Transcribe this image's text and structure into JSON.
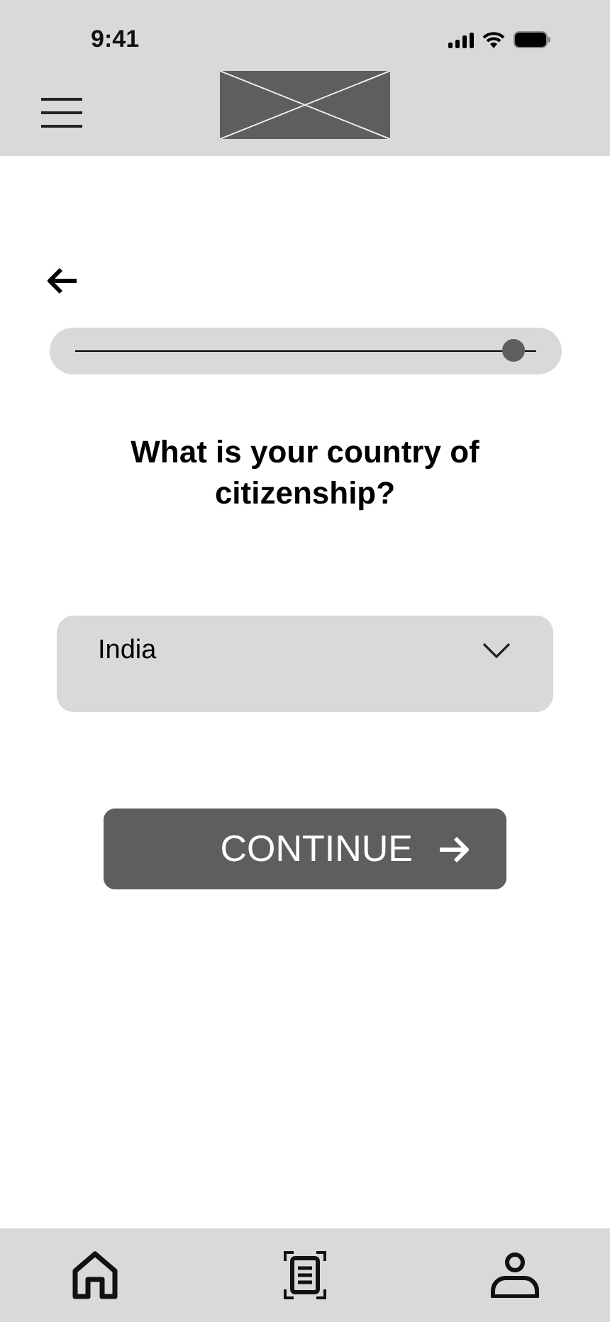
{
  "status_bar": {
    "time": "9:41"
  },
  "progress": {
    "level": 0.96
  },
  "question": "What is your country of citizenship?",
  "country_select": {
    "value": "India"
  },
  "continue_button": {
    "label": "CONTINUE"
  },
  "bottom_nav": [
    {
      "kind": "home"
    },
    {
      "kind": "scan"
    },
    {
      "kind": "profile"
    }
  ]
}
